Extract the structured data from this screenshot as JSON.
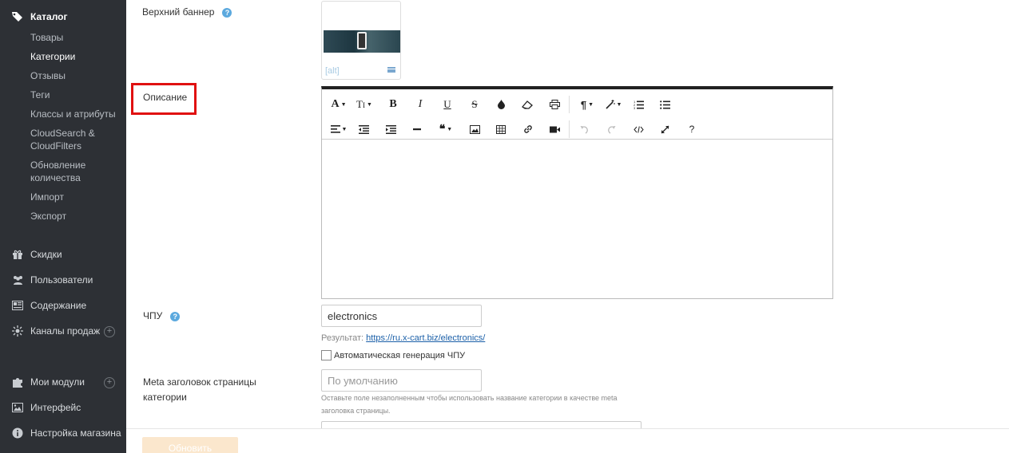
{
  "sidebar": {
    "catalog_label": "Каталог",
    "sub_items": [
      {
        "label": "Товары"
      },
      {
        "label": "Категории"
      },
      {
        "label": "Отзывы"
      },
      {
        "label": "Теги"
      },
      {
        "label": "Классы и атрибуты"
      },
      {
        "label": "CloudSearch &",
        "label2": "CloudFilters"
      },
      {
        "label": "Обновление",
        "label2": "количества"
      },
      {
        "label": "Импорт"
      },
      {
        "label": "Экспорт"
      }
    ],
    "main_items": [
      {
        "label": "Скидки",
        "icon": "gift-icon"
      },
      {
        "label": "Пользователи",
        "icon": "users-icon"
      },
      {
        "label": "Содержание",
        "icon": "content-icon"
      },
      {
        "label": "Каналы продаж",
        "icon": "channels-icon",
        "plus": "+"
      },
      {
        "label": "Мои модули",
        "icon": "puzzle-icon",
        "plus": "+"
      },
      {
        "label": "Интерфейс",
        "icon": "image-icon"
      },
      {
        "label": "Настройка магазина",
        "icon": "info-icon"
      }
    ]
  },
  "form": {
    "banner_label": "Верхний баннер",
    "banner_alt": "[alt]",
    "description_label": "Описание",
    "slug_label": "ЧПУ",
    "slug_value": "electronics",
    "result_label": "Результат:",
    "result_url": "https://ru.x-cart.biz/electronics/",
    "auto_slug_label": "Автоматическая генерация ЧПУ",
    "meta_title_label_line1": "Meta заголовок страницы",
    "meta_title_label_line2": "категории",
    "meta_title_placeholder": "По умолчанию",
    "meta_hint_line1": "Оставьте поле незаполненным чтобы использовать название категории в качестве meta",
    "meta_hint_line2": "заголовка страницы.",
    "help_glyph": "?"
  },
  "editor": {
    "help_button": "?"
  },
  "footer": {
    "save_label": "Обновить"
  },
  "colors": {
    "sidebar_bg": "#2d3035",
    "highlight": "#e01010",
    "link": "#1a5fa8",
    "help": "#5ca9de"
  }
}
